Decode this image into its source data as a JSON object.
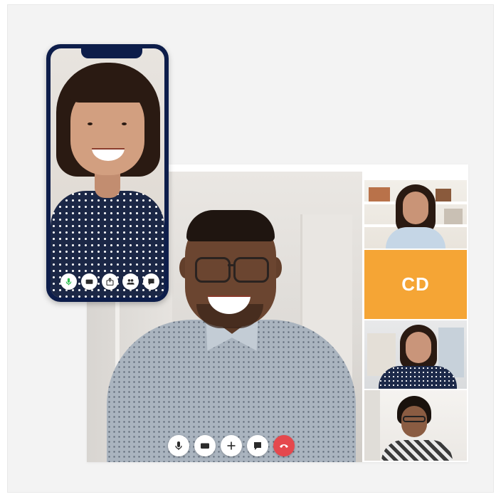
{
  "colors": {
    "accent_orange": "#f5a535",
    "phone_frame": "#0d1d4a",
    "end_call_red": "#e5484d",
    "mic_active_green": "#2fbf4f"
  },
  "desktop": {
    "side_tiles": [
      {
        "kind": "video"
      },
      {
        "kind": "initials",
        "initials": "CD"
      },
      {
        "kind": "video"
      },
      {
        "kind": "video"
      }
    ],
    "controls": [
      {
        "icon": "microphone-icon"
      },
      {
        "icon": "video-camera-icon"
      },
      {
        "icon": "plus-icon"
      },
      {
        "icon": "chat-bubble-icon"
      },
      {
        "icon": "end-call-icon"
      }
    ]
  },
  "phone": {
    "controls": [
      {
        "icon": "microphone-icon"
      },
      {
        "icon": "video-camera-icon"
      },
      {
        "icon": "share-icon"
      },
      {
        "icon": "participants-icon"
      },
      {
        "icon": "chat-bubble-icon"
      }
    ]
  }
}
